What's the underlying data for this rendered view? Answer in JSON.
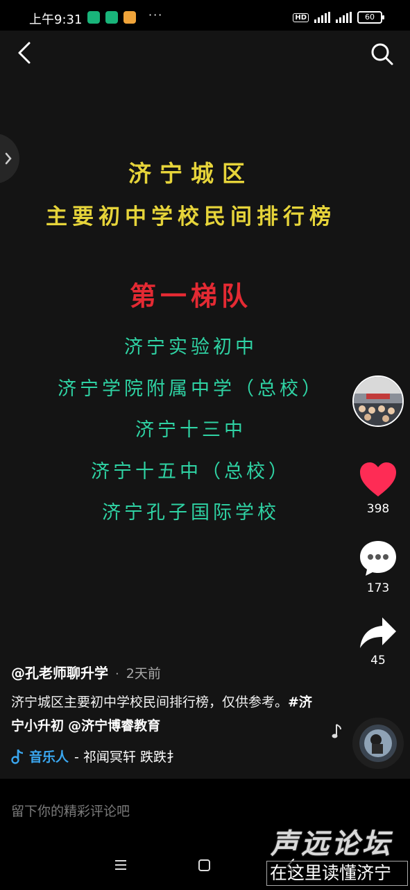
{
  "status_bar": {
    "time": "上午9:31",
    "more": "···",
    "hd": "HD",
    "battery": "60"
  },
  "poster": {
    "title_line1": "济宁城区",
    "title_line2": "主要初中学校民间排行榜",
    "tier": "第一梯队",
    "schools": [
      "济宁实验初中",
      "济宁学院附属中学（总校）",
      "济宁十三中",
      "济宁十五中（总校）",
      "济宁孔子国际学校"
    ],
    "colors": {
      "title": "#e6d43a",
      "tier": "#e42a33",
      "schools": "#2fd3a4"
    }
  },
  "actions": {
    "likes": "398",
    "comments": "173",
    "shares": "45"
  },
  "post": {
    "author": "@孔老师聊升学",
    "time": "2天前",
    "description": "济宁城区主要初中学校民间排行榜，仅供参考。",
    "hashtag": "#济宁小升初",
    "mention": "@济宁博睿教育"
  },
  "music": {
    "artist": "音乐人",
    "text": "- 祁闻冥轩    跌跌扌"
  },
  "comment": {
    "placeholder": "留下你的精彩评论吧"
  },
  "watermark": {
    "line1": "声远论坛",
    "line2": "在这里读懂济宁"
  },
  "icons": [
    "back-icon",
    "search-icon",
    "chevron-right-icon",
    "heart-icon",
    "comment-icon",
    "share-icon",
    "music-note-icon",
    "menu-icon",
    "home-icon",
    "nav-back-icon"
  ]
}
